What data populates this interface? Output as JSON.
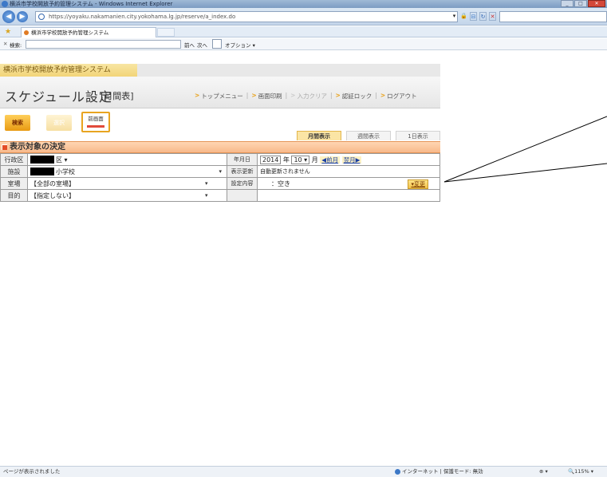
{
  "browser": {
    "window_title": "横浜市学校開放予約管理システム - Windows Internet Explorer",
    "url": "https://yoyaku.nakamanien.city.yokohama.lg.jp/reserve/a_index.do",
    "tab_title": "横浜市学校開放予約管理システム",
    "find_label": "検索:",
    "find_prev": "前へ",
    "find_next": "次へ",
    "find_options": "オプション ▾",
    "status_left": "ページが表示されました",
    "status_zone": "インターネット | 保護モード: 無効",
    "status_icons": "⊕ ▾",
    "zoom": "115%"
  },
  "app": {
    "system_name": "横浜市学校開放予約管理システム",
    "page_title": "スケジュール設定",
    "page_title_sub": "[月間表]",
    "topnav": [
      {
        "label": "トップメニュー"
      },
      {
        "label": "画面印刷"
      },
      {
        "label": "入力クリア"
      },
      {
        "label": "認証ロック"
      },
      {
        "label": "ログアウト"
      }
    ],
    "buttons": {
      "search": "検索",
      "select": "選択",
      "prev_screen": "前画面"
    },
    "view_tabs": [
      "月間表示",
      "週間表示",
      "1日表示"
    ],
    "section_title": "表示対象の決定"
  },
  "form": {
    "ward_label": "行政区",
    "ward_value": "区 ▾",
    "facility_label": "施設",
    "facility_value": "小学校",
    "room_label": "室場",
    "room_value": "【全部の室場】",
    "purpose_label": "目的",
    "purpose_value": "【指定しない】",
    "date_label": "年月日",
    "year": "2014",
    "year_unit": "年",
    "month": "10 ▾",
    "month_unit": "月",
    "prev_month": "◀前月",
    "next_month": "翌月▶",
    "refresh_label": "表示更新",
    "refresh_value": "自動更新されません",
    "setting_label": "設定内容",
    "setting_value": "：空き",
    "change_button": "▾変更"
  }
}
